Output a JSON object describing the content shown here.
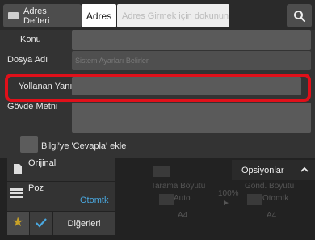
{
  "topbar": {
    "address_book_label_line1": "Adres",
    "address_book_label_line2": "Defteri",
    "adres_tab_label": "Adres",
    "address_placeholder": "Adres Girmek için dokunun"
  },
  "form": {
    "konu_label": "Konu",
    "dosya_adi_label": "Dosya Adı",
    "dosya_adi_placeholder": "Sistem Ayarları Belirler",
    "yollanan_yanit_label": "Yollanan Yanıt",
    "govde_metni_label": "Gövde Metni",
    "bcc_checkbox_label": "Bilgi'ye 'Cevapla' ekle"
  },
  "bottom": {
    "orijinal_label": "Orijinal",
    "poz_label": "Poz",
    "poz_value": "Otomtk",
    "digerleri_label": "Diğerleri",
    "opsiyonlar_label": "Opsiyonlar",
    "tarama_boyutu_label": "Tarama Boyutu",
    "tarama_boyutu_value": "Auto",
    "tarama_boyutu_paper": "A4",
    "zoom_value": "100%",
    "gond_boyutu_label": "Gönd. Boyutu",
    "gond_boyutu_value": "Otomtk",
    "gond_boyutu_paper": "A4"
  },
  "colors": {
    "highlight": "#e0101a",
    "accent_blue": "#4aa8e0"
  }
}
